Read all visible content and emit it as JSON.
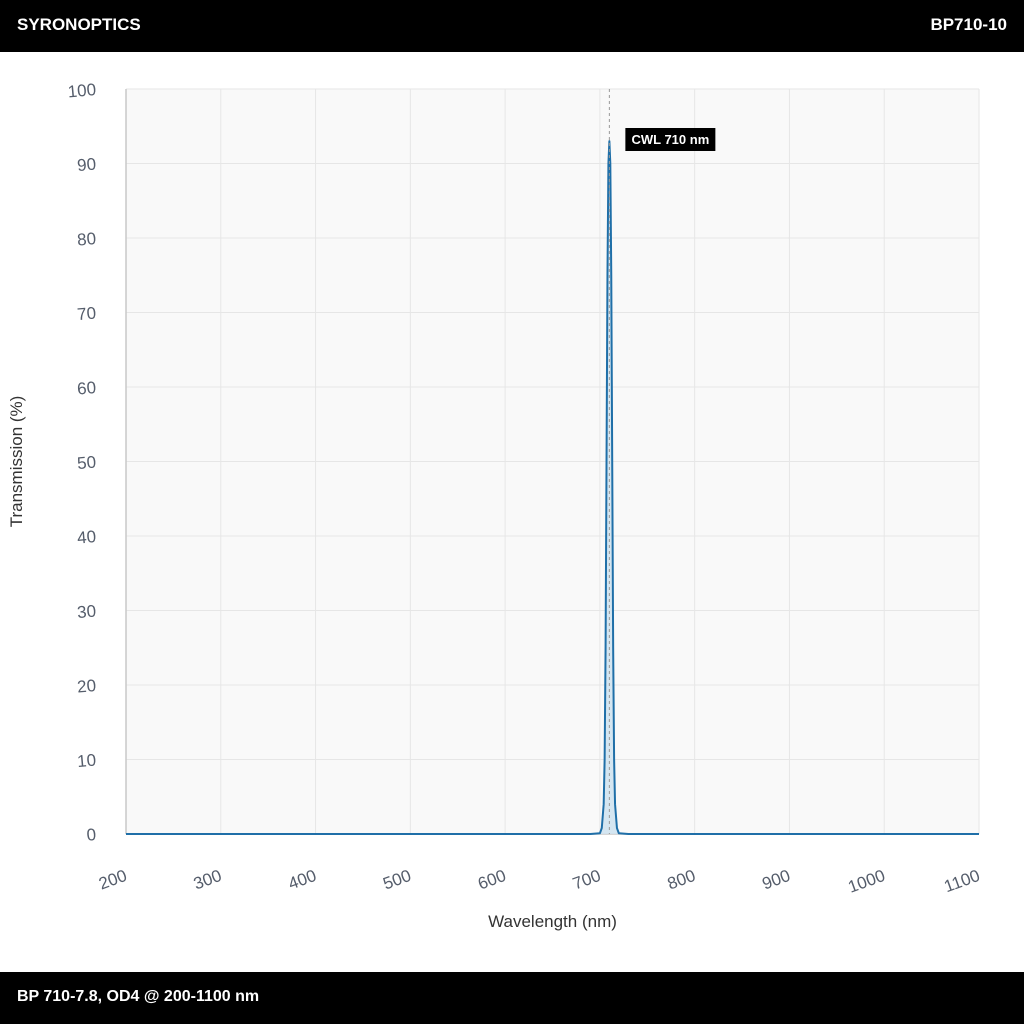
{
  "header": {
    "brand": "SYRONOPTICS",
    "part_number": "BP710-10"
  },
  "footer": {
    "description": "BP 710-7.8, OD4 @ 200-1100 nm"
  },
  "colors": {
    "line": "#1f6fa8",
    "fill": "#cfe3f0",
    "grid": "#e6e6e6",
    "plot_bg": "#f9f9f9",
    "marker": "#999999"
  },
  "chart_data": {
    "type": "line",
    "xlabel": "Wavelength (nm)",
    "ylabel": "Transmission (%)",
    "xlim": [
      200,
      1100
    ],
    "ylim": [
      0,
      100
    ],
    "xticks": [
      200,
      300,
      400,
      500,
      600,
      700,
      800,
      900,
      1000,
      1100
    ],
    "yticks": [
      0,
      10,
      20,
      30,
      40,
      50,
      60,
      70,
      80,
      90,
      100
    ],
    "grid": true,
    "series": [
      {
        "x": [
          200,
          690,
          700,
          702,
          704,
          705,
          706,
          707,
          708,
          709,
          710,
          711,
          712,
          713,
          714,
          715,
          716,
          718,
          720,
          730,
          1100
        ],
        "y": [
          0,
          0,
          0.1,
          0.8,
          4,
          10,
          25,
          50,
          75,
          90,
          93,
          90,
          75,
          50,
          25,
          10,
          4,
          0.8,
          0.1,
          0,
          0
        ]
      }
    ],
    "annotations": [
      {
        "x": 710,
        "label": "CWL 710 nm"
      }
    ]
  }
}
